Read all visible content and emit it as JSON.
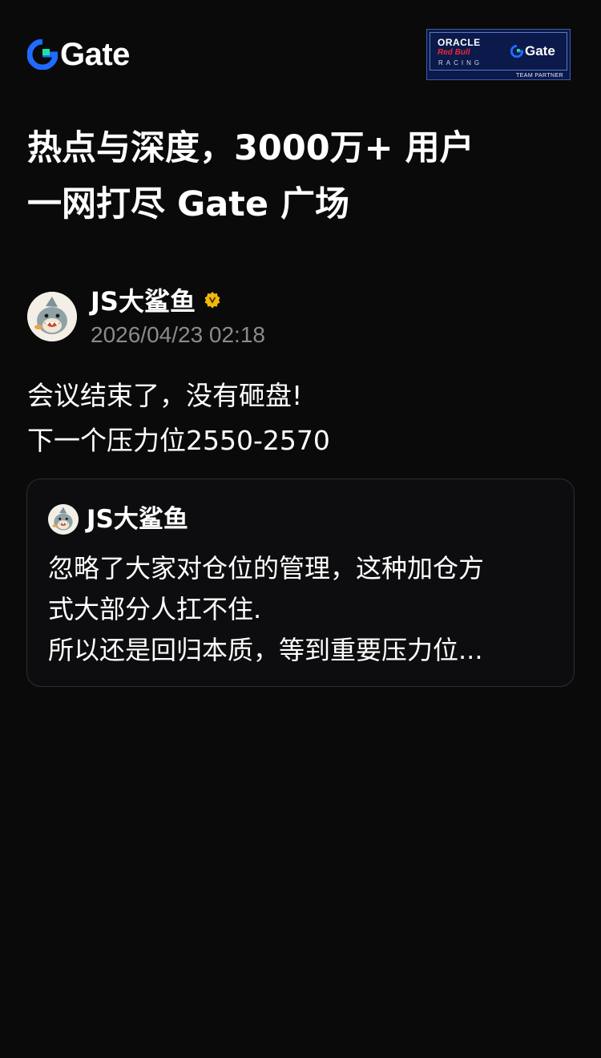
{
  "header": {
    "logo_text": "Gate",
    "partner": {
      "oracle": "ORACLE",
      "redbull": "Red Bull",
      "racing": "RACING",
      "gate": "Gate",
      "footer": "TEAM PARTNER"
    }
  },
  "headline": {
    "line1": "热点与深度，3000万+ 用户",
    "line2": "一网打尽 Gate 广场"
  },
  "post": {
    "author": "JS大鲨鱼",
    "verified_icon": "verified-badge-icon",
    "timestamp": "2026/04/23 02:18",
    "body_line1": "会议结束了，没有砸盘!",
    "body_line2": "下一个压力位2550-2570"
  },
  "quote": {
    "author": "JS大鲨鱼",
    "line1": "忽略了大家对仓位的管理，这种加仓方",
    "line2": "式大部分人扛不住.",
    "line3": "所以还是回归本质，等到重要压力位..."
  },
  "colors": {
    "background": "#0a0a0a",
    "brand_blue": "#1f6bff",
    "brand_green": "#17e5a2",
    "timestamp_gray": "#8a8a8f",
    "verified_gold": "#f0b90b"
  }
}
